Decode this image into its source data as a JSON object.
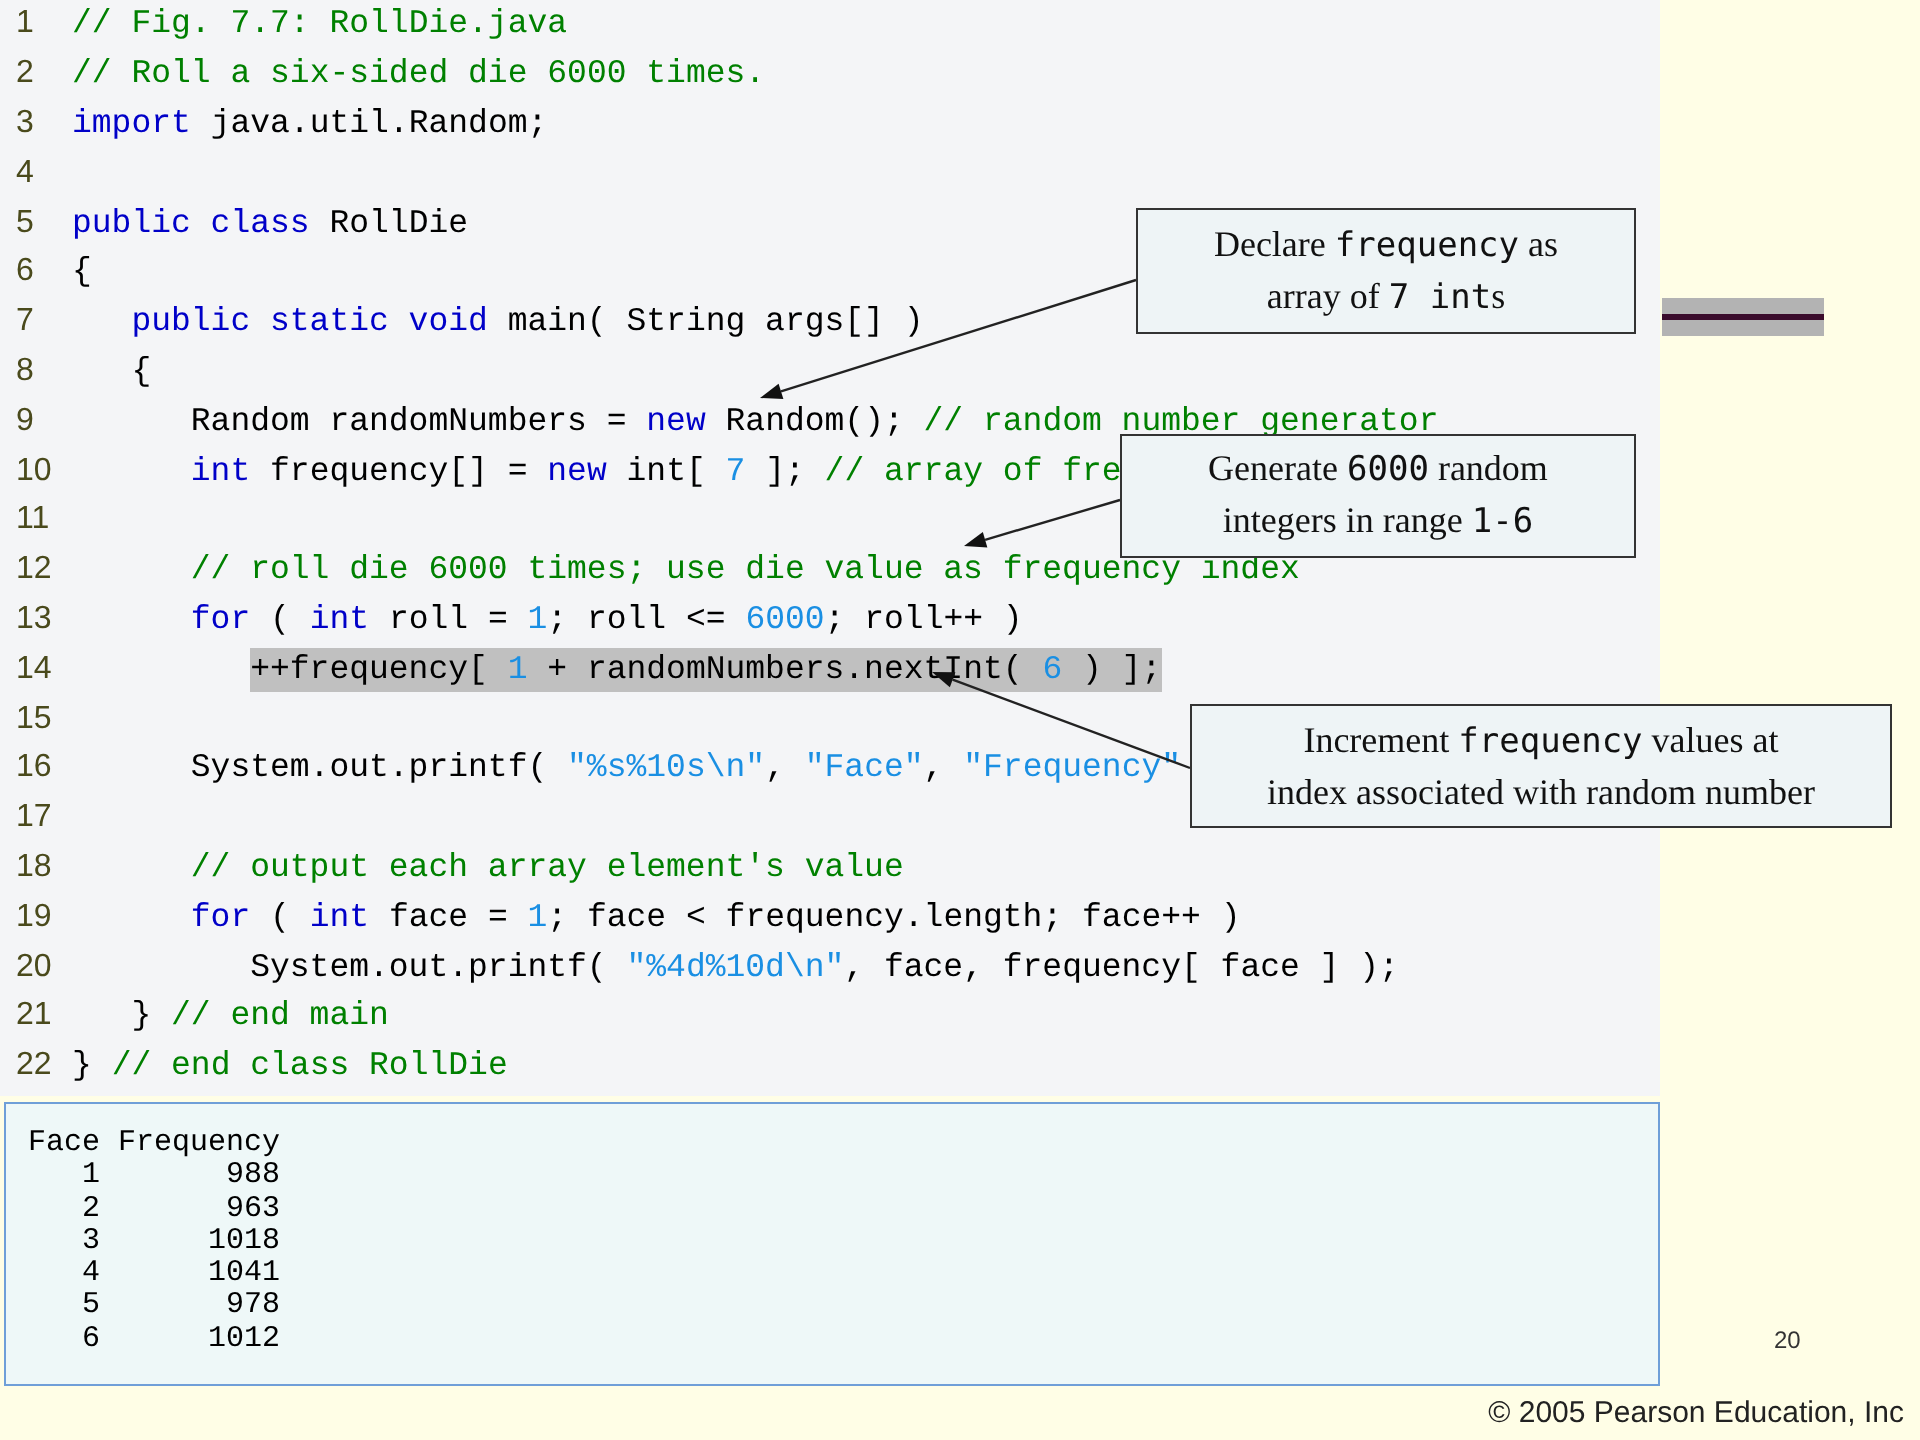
{
  "code": {
    "lines": [
      {
        "number": "1",
        "highlighted": false,
        "tokens": [
          {
            "kind": "comment",
            "text": "// Fig. 7.7: RollDie.java"
          }
        ]
      },
      {
        "number": "2",
        "highlighted": false,
        "tokens": [
          {
            "kind": "comment",
            "text": "// Roll a six-sided die 6000 times."
          }
        ]
      },
      {
        "number": "3",
        "highlighted": false,
        "tokens": [
          {
            "kind": "keyword",
            "text": "import"
          },
          {
            "kind": "plain",
            "text": " java.util.Random;"
          }
        ]
      },
      {
        "number": "4"
      },
      {
        "number": "5",
        "highlighted": false,
        "tokens": [
          {
            "kind": "keyword",
            "text": "public class"
          },
          {
            "kind": "plain",
            "text": " RollDie"
          }
        ]
      },
      {
        "number": "6",
        "highlighted": false,
        "tokens": [
          {
            "kind": "plain",
            "text": "{"
          }
        ],
        "children": [
          {
            "number": "7",
            "highlighted": false,
            "tokens": [
              {
                "kind": "keyword",
                "text": "public static void"
              },
              {
                "kind": "plain",
                "text": " main( String args[] )"
              }
            ]
          },
          {
            "number": "8",
            "highlighted": false,
            "tokens": [
              {
                "kind": "plain",
                "text": "{"
              }
            ],
            "children": [
              {
                "number": "9",
                "highlighted": false,
                "tokens": [
                  {
                    "kind": "plain",
                    "text": "Random randomNumbers = "
                  },
                  {
                    "kind": "keyword",
                    "text": "new"
                  },
                  {
                    "kind": "plain",
                    "text": " Random(); "
                  },
                  {
                    "kind": "comment",
                    "text": "// random number generator"
                  }
                ]
              },
              {
                "number": "10",
                "highlighted": false,
                "tokens": [
                  {
                    "kind": "keyword",
                    "text": "int"
                  },
                  {
                    "kind": "plain",
                    "text": " frequency[] = "
                  },
                  {
                    "kind": "keyword",
                    "text": "new"
                  },
                  {
                    "kind": "plain",
                    "text": " int[ "
                  },
                  {
                    "kind": "number",
                    "text": "7"
                  },
                  {
                    "kind": "plain",
                    "text": " ]; "
                  },
                  {
                    "kind": "comment",
                    "text": "// array of fre"
                  }
                ]
              },
              {
                "number": "11"
              },
              {
                "number": "12",
                "highlighted": false,
                "tokens": [
                  {
                    "kind": "comment",
                    "text": "// roll die 6000 times; use die value as frequency index"
                  }
                ]
              },
              {
                "number": "13",
                "highlighted": false,
                "tokens": [
                  {
                    "kind": "keyword",
                    "text": "for"
                  },
                  {
                    "kind": "plain",
                    "text": " ( "
                  },
                  {
                    "kind": "keyword",
                    "text": "int"
                  },
                  {
                    "kind": "plain",
                    "text": " roll = "
                  },
                  {
                    "kind": "number",
                    "text": "1"
                  },
                  {
                    "kind": "plain",
                    "text": "; roll <= "
                  },
                  {
                    "kind": "number",
                    "text": "6000"
                  },
                  {
                    "kind": "plain",
                    "text": "; roll++ )"
                  }
                ],
                "children": [
                  {
                    "number": "14",
                    "highlighted": true,
                    "tokens": [
                      {
                        "kind": "plain",
                        "text": "++frequency[ "
                      },
                      {
                        "kind": "number",
                        "text": "1"
                      },
                      {
                        "kind": "plain",
                        "text": " + randomNumbers.nextInt( "
                      },
                      {
                        "kind": "number",
                        "text": "6"
                      },
                      {
                        "kind": "plain",
                        "text": " ) ];"
                      }
                    ]
                  }
                ]
              },
              {
                "number": "15"
              },
              {
                "number": "16",
                "highlighted": false,
                "tokens": [
                  {
                    "kind": "plain",
                    "text": "System.out.printf( "
                  },
                  {
                    "kind": "string",
                    "text": "\"%s%10s\\n\""
                  },
                  {
                    "kind": "plain",
                    "text": ", "
                  },
                  {
                    "kind": "string",
                    "text": "\"Face\""
                  },
                  {
                    "kind": "plain",
                    "text": ", "
                  },
                  {
                    "kind": "string",
                    "text": "\"Frequency\""
                  }
                ]
              },
              {
                "number": "17"
              },
              {
                "number": "18",
                "highlighted": false,
                "tokens": [
                  {
                    "kind": "comment",
                    "text": "// output each array element's value"
                  }
                ]
              },
              {
                "number": "19",
                "highlighted": false,
                "tokens": [
                  {
                    "kind": "keyword",
                    "text": "for"
                  },
                  {
                    "kind": "plain",
                    "text": " ( "
                  },
                  {
                    "kind": "keyword",
                    "text": "int"
                  },
                  {
                    "kind": "plain",
                    "text": " face = "
                  },
                  {
                    "kind": "number",
                    "text": "1"
                  },
                  {
                    "kind": "plain",
                    "text": "; face < frequency.length; face++ )"
                  }
                ],
                "children": [
                  {
                    "number": "20",
                    "highlighted": false,
                    "tokens": [
                      {
                        "kind": "plain",
                        "text": "System.out.printf( "
                      },
                      {
                        "kind": "string",
                        "text": "\"%4d%10d\\n\""
                      },
                      {
                        "kind": "plain",
                        "text": ", face, frequency[ face ] );"
                      }
                    ]
                  }
                ]
              }
            ]
          },
          {
            "number": "21",
            "highlighted": false,
            "tokens": [
              {
                "kind": "plain",
                "text": "} "
              },
              {
                "kind": "comment",
                "text": "// end main"
              }
            ]
          }
        ]
      },
      {
        "number": "22",
        "highlighted": false,
        "tokens": [
          {
            "kind": "plain",
            "text": "} "
          },
          {
            "kind": "comment",
            "text": "// end class RollDie"
          }
        ]
      }
    ]
  },
  "callouts": [
    {
      "lines": [
        [
          {
            "kind": "text",
            "text": "Declare "
          },
          {
            "kind": "code",
            "text": "frequency"
          },
          {
            "kind": "text",
            "text": " as"
          }
        ],
        [
          {
            "kind": "text",
            "text": "array of "
          },
          {
            "kind": "code",
            "text": "7 int"
          },
          {
            "kind": "text",
            "text": "s"
          }
        ]
      ]
    },
    {
      "lines": [
        [
          {
            "kind": "text",
            "text": "Generate "
          },
          {
            "kind": "code",
            "text": "6000"
          },
          {
            "kind": "text",
            "text": " random"
          }
        ],
        [
          {
            "kind": "text",
            "text": "integers in range "
          },
          {
            "kind": "code",
            "text": "1-6"
          }
        ]
      ]
    },
    {
      "lines": [
        [
          {
            "kind": "text",
            "text": "Increment "
          },
          {
            "kind": "code",
            "text": "frequency"
          },
          {
            "kind": "text",
            "text": " values at"
          }
        ],
        [
          {
            "kind": "text",
            "text": "index associated with random number"
          }
        ]
      ]
    }
  ],
  "output": {
    "headers": [
      "Face",
      "Frequency"
    ],
    "rows": [
      {
        "face": "1",
        "frequency": "988"
      },
      {
        "face": "2",
        "frequency": "963"
      },
      {
        "face": "3",
        "frequency": "1018"
      },
      {
        "face": "4",
        "frequency": "1041"
      },
      {
        "face": "5",
        "frequency": "978"
      },
      {
        "face": "6",
        "frequency": "1012"
      }
    ]
  },
  "page_number": "20",
  "copyright": "© 2005 Pearson Education, Inc"
}
